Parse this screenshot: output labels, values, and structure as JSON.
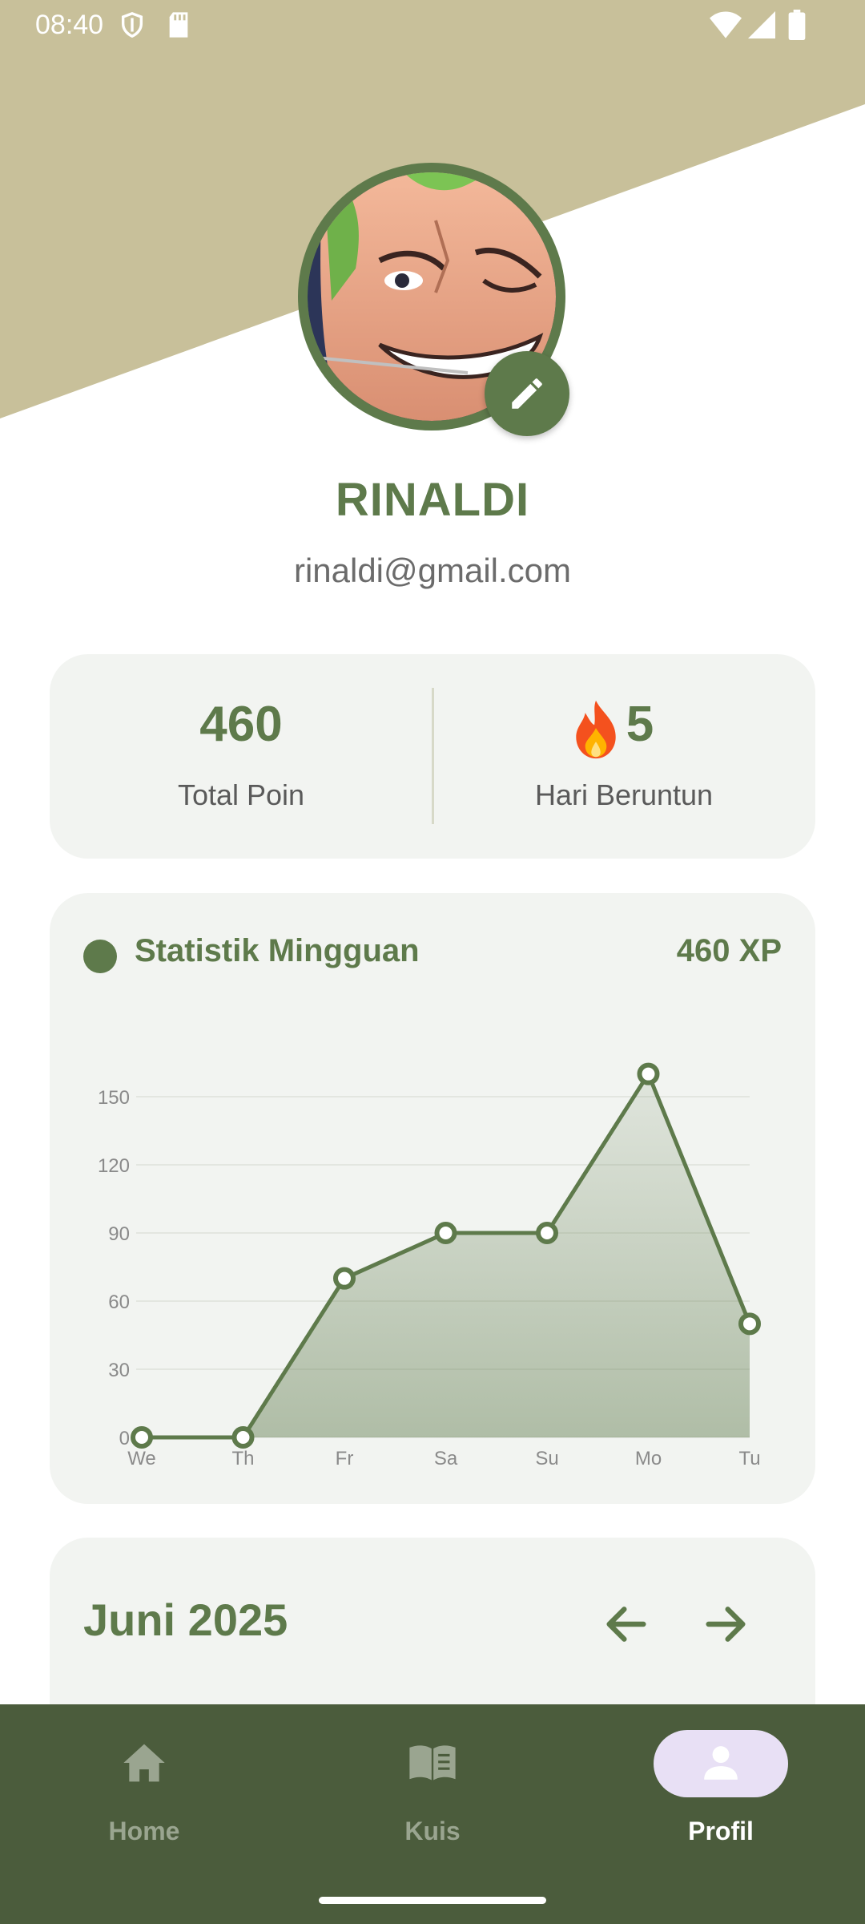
{
  "status_bar": {
    "time": "08:40"
  },
  "profile": {
    "name": "RINALDI",
    "email": "rinaldi@gmail.com"
  },
  "stats": {
    "total_points_value": "460",
    "total_points_label": "Total Poin",
    "streak_value": "5",
    "streak_label": "Hari Beruntun",
    "streak_icon": "fire-icon"
  },
  "weekly": {
    "title": "Statistik Mingguan",
    "xp": "460 XP"
  },
  "calendar": {
    "title": "Juni 2025"
  },
  "nav": {
    "items": [
      {
        "label": "Home",
        "icon": "home-icon"
      },
      {
        "label": "Kuis",
        "icon": "book-icon"
      },
      {
        "label": "Profil",
        "icon": "person-icon",
        "active": true
      }
    ]
  },
  "colors": {
    "primary": "#5e7a4b",
    "header_band": "#c8c09a",
    "card_bg": "#f2f4f1",
    "nav_bg": "#4b5c3c",
    "active_pill": "#e8e0f5"
  },
  "chart_data": {
    "type": "area",
    "categories": [
      "We",
      "Th",
      "Fr",
      "Sa",
      "Su",
      "Mo",
      "Tu"
    ],
    "values": [
      0,
      0,
      70,
      90,
      90,
      160,
      50
    ],
    "yticks": [
      0,
      30,
      60,
      90,
      120,
      150
    ],
    "ylim": [
      0,
      160
    ],
    "grid": true,
    "title": "",
    "xlabel": "",
    "ylabel": ""
  }
}
